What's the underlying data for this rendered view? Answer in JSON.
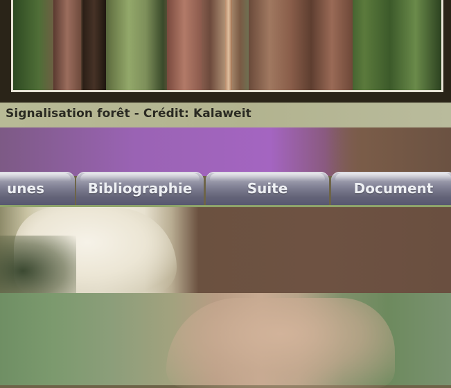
{
  "photo": {
    "caption": "Signalisation forêt - Crédit: Kalaweit"
  },
  "tabs": [
    {
      "label": "unes"
    },
    {
      "label": "Bibliographie"
    },
    {
      "label": "Suite"
    },
    {
      "label": "Document"
    }
  ],
  "colors": {
    "tab_text": "#eef0f4",
    "caption_bg": "#b8ba96",
    "purple_band": "#a465c1",
    "tab_underline": "#8fa46a"
  }
}
